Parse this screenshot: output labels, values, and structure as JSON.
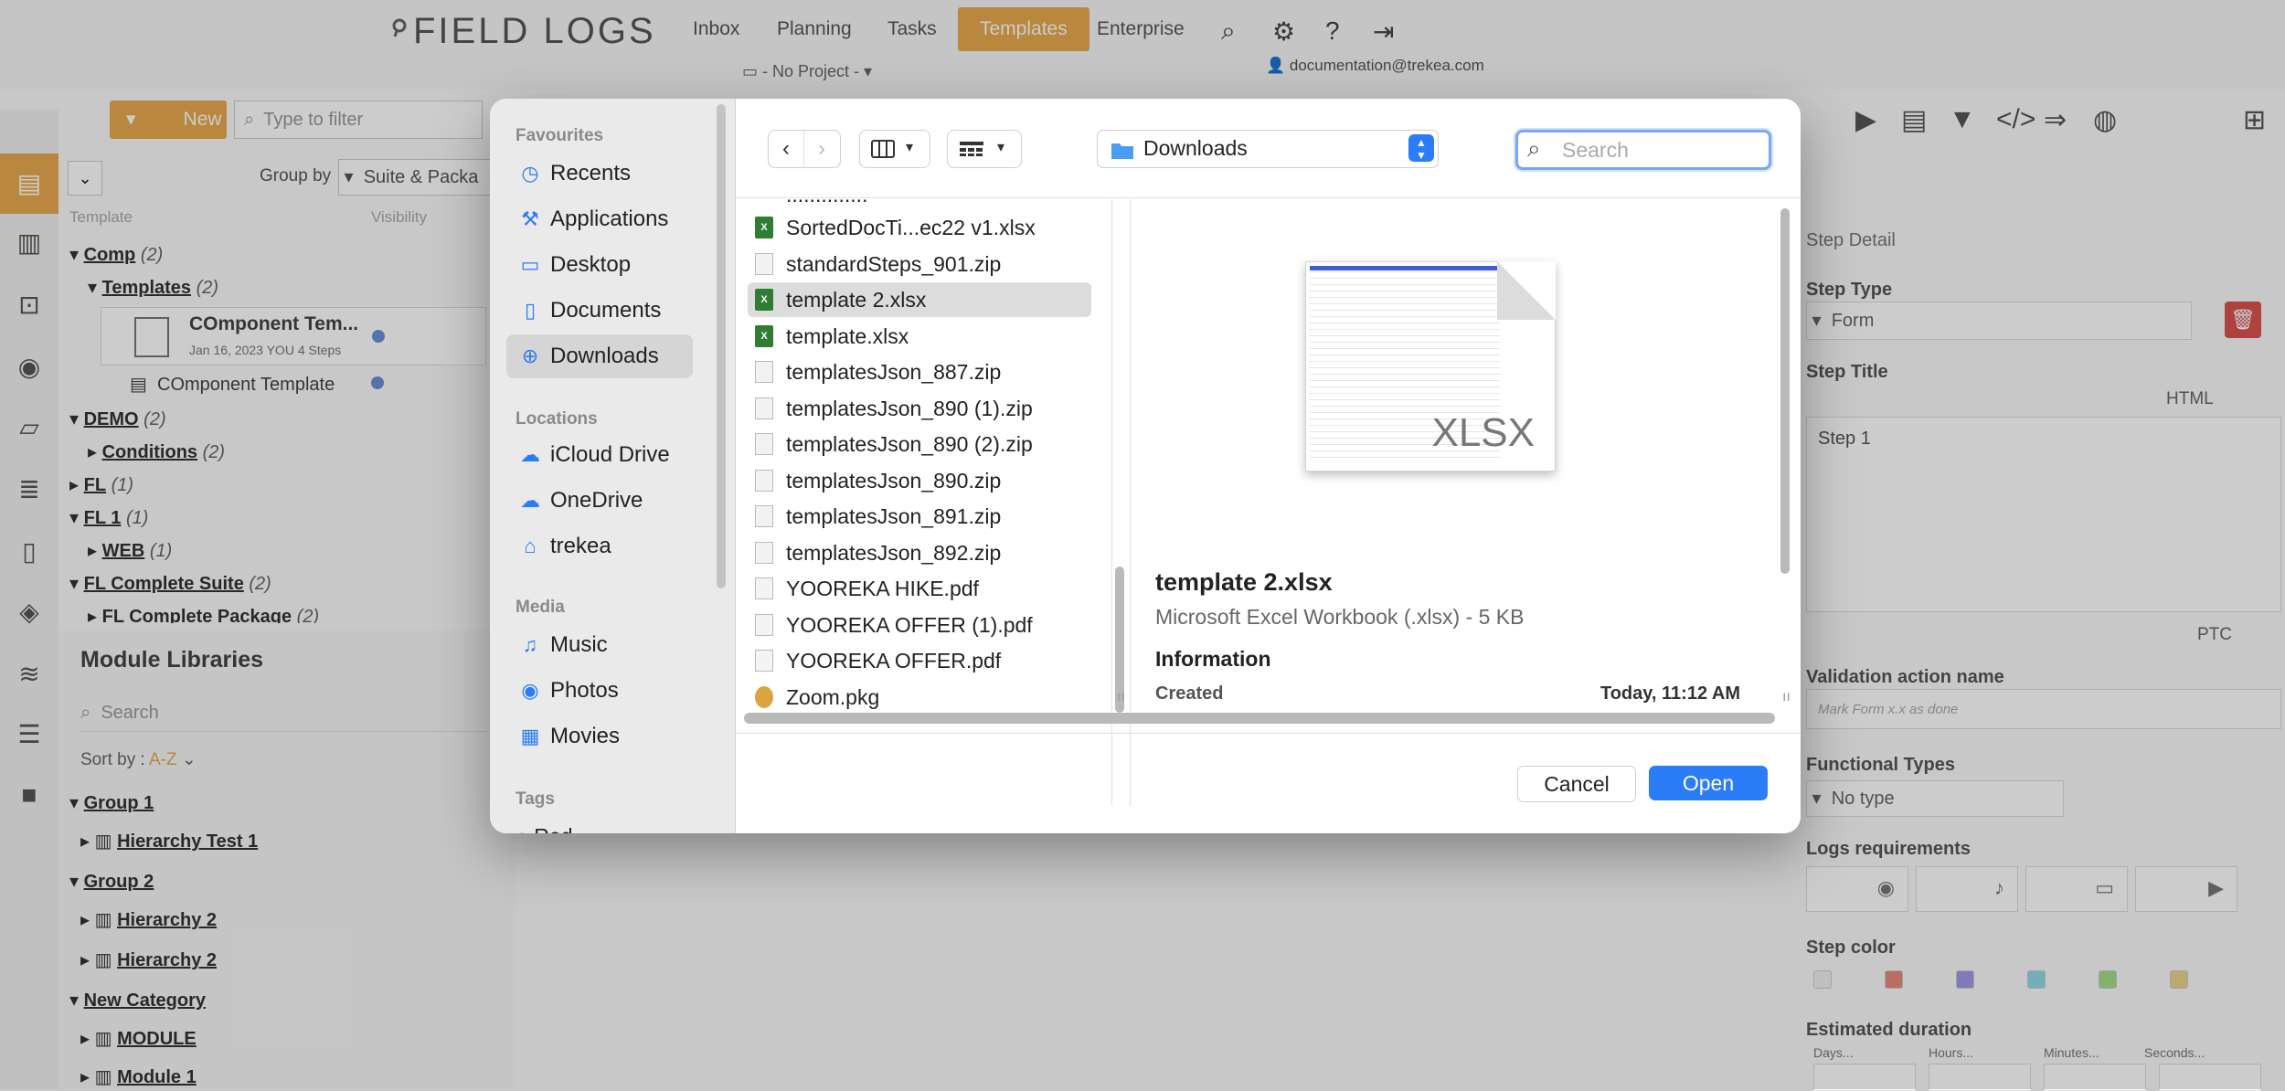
{
  "app": {
    "logo": "FIELD LOGS",
    "nav": [
      "Inbox",
      "Planning",
      "Tasks",
      "Templates",
      "Enterprise"
    ],
    "active_nav": "Templates",
    "project": "- No Project -",
    "user_email": "documentation@trekea.com",
    "new_label": "New",
    "filter_placeholder": "Type to filter",
    "group_by_label": "Group by",
    "group_by_value": "Suite & Packa",
    "col_template": "Template",
    "col_visibility": "Visibility",
    "tree": [
      {
        "label": "Comp",
        "count": "(2)"
      },
      {
        "label": "Templates",
        "count": "(2)"
      },
      {
        "label": "DEMO",
        "count": "(2)"
      },
      {
        "label": "Conditions",
        "count": "(2)"
      },
      {
        "label": "FL",
        "count": "(1)"
      },
      {
        "label": "FL 1",
        "count": "(1)"
      },
      {
        "label": "WEB",
        "count": "(1)"
      },
      {
        "label": "FL Complete Suite",
        "count": "(2)"
      },
      {
        "label": "FL Complete Package",
        "count": "(2)"
      }
    ],
    "card_title": "COmponent Tem...",
    "card_meta": "Jan 16, 2023  YOU  4 Steps",
    "component_row": "COmponent Template",
    "module_libraries": "Module Libraries",
    "module_search": "Search",
    "sort_label": "Sort by :",
    "sort_value": "A-Z",
    "modules": [
      "Group 1",
      "Hierarchy Test 1",
      "Group 2",
      "Hierarchy 2",
      "Hierarchy 2",
      "New Category",
      "MODULE",
      "Module 1"
    ],
    "right": {
      "step_detail": "Step Detail",
      "step_type": "Step Type",
      "step_type_value": "Form",
      "step_title": "Step Title",
      "html": "HTML",
      "step_title_value": "Step 1",
      "ptc": "PTC",
      "validation": "Validation action name",
      "validation_placeholder": "Mark Form x.x as done",
      "functional": "Functional Types",
      "functional_value": "No type",
      "logs": "Logs requirements",
      "step_color": "Step color",
      "duration": "Estimated duration",
      "duration_fields": [
        "Days...",
        "Hours...",
        "Minutes...",
        "Seconds..."
      ],
      "colors": [
        "#f0f0f0",
        "#e88a7a",
        "#a39ae8",
        "#8fdbe6",
        "#a6de8c",
        "#e8d58c"
      ]
    }
  },
  "dialog": {
    "sidebar": {
      "favourites": "Favourites",
      "fav_items": [
        {
          "icon": "clock-icon",
          "glyph": "◷",
          "label": "Recents"
        },
        {
          "icon": "applications-icon",
          "glyph": "⚒",
          "label": "Applications"
        },
        {
          "icon": "desktop-icon",
          "glyph": "▭",
          "label": "Desktop"
        },
        {
          "icon": "documents-icon",
          "glyph": "▯",
          "label": "Documents"
        },
        {
          "icon": "downloads-icon",
          "glyph": "⊕",
          "label": "Downloads"
        }
      ],
      "locations": "Locations",
      "loc_items": [
        {
          "icon": "cloud-icon",
          "glyph": "☁",
          "label": "iCloud Drive"
        },
        {
          "icon": "cloud-icon",
          "glyph": "☁",
          "label": "OneDrive"
        },
        {
          "icon": "drive-icon",
          "glyph": "⌂",
          "label": "trekea"
        }
      ],
      "media": "Media",
      "media_items": [
        {
          "icon": "music-icon",
          "glyph": "♫",
          "label": "Music"
        },
        {
          "icon": "camera-icon",
          "glyph": "◉",
          "label": "Photos"
        },
        {
          "icon": "film-icon",
          "glyph": "▦",
          "label": "Movies"
        }
      ],
      "tags": "Tags",
      "tag_partial": "Red"
    },
    "location": "Downloads",
    "search_placeholder": "Search",
    "files": [
      {
        "name": "SortedDocTi...ec22 v1.xlsx",
        "type": "x"
      },
      {
        "name": "standardSteps_901.zip",
        "type": "z"
      },
      {
        "name": "template 2.xlsx",
        "type": "x"
      },
      {
        "name": "template.xlsx",
        "type": "x"
      },
      {
        "name": "templatesJson_887.zip",
        "type": "z"
      },
      {
        "name": "templatesJson_890 (1).zip",
        "type": "z"
      },
      {
        "name": "templatesJson_890 (2).zip",
        "type": "z"
      },
      {
        "name": "templatesJson_890.zip",
        "type": "z"
      },
      {
        "name": "templatesJson_891.zip",
        "type": "z"
      },
      {
        "name": "templatesJson_892.zip",
        "type": "z"
      },
      {
        "name": "YOOREKA HIKE.pdf",
        "type": "p"
      },
      {
        "name": "YOOREKA OFFER (1).pdf",
        "type": "p"
      },
      {
        "name": "YOOREKA OFFER.pdf",
        "type": "p"
      },
      {
        "name": "Zoom.pkg",
        "type": "k"
      }
    ],
    "selected_index": 2,
    "preview": {
      "badge": "XLSX",
      "name": "template 2.xlsx",
      "kind": "Microsoft Excel Workbook (.xlsx) - 5 KB",
      "info": "Information",
      "created_label": "Created",
      "created_value": "Today, 11:12 AM"
    },
    "cancel": "Cancel",
    "open": "Open"
  }
}
